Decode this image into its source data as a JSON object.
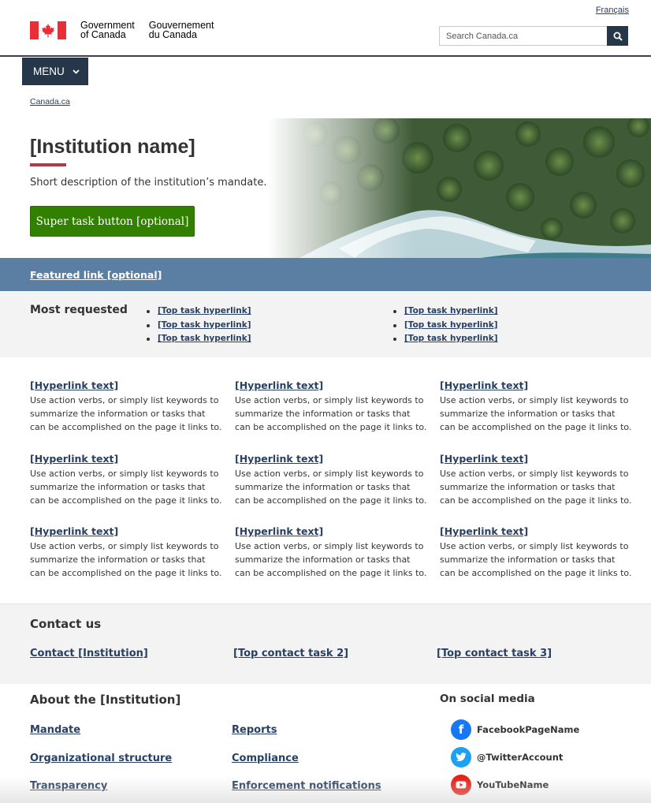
{
  "header": {
    "language_toggle": "Français",
    "signature": {
      "en_line1": "Government",
      "en_line2": "of Canada",
      "fr_line1": "Gouvernement",
      "fr_line2": "du Canada"
    },
    "search_placeholder": "Search Canada.ca",
    "search_icon": "search-icon",
    "accent_color": "#26374a",
    "flag_color": "#eb2d37"
  },
  "menu": {
    "label": "MENU"
  },
  "breadcrumb": {
    "items": [
      "Canada.ca"
    ]
  },
  "hero": {
    "title": "[Institution name]",
    "description": "Short description of the institution’s mandate.",
    "button_label": "Super task button [optional]",
    "button_color": "#318000"
  },
  "featured": {
    "label": "Featured link [optional]",
    "color": "#5a7fa3"
  },
  "most_requested": {
    "title": "Most requested",
    "col1": [
      "[Top task hyperlink]",
      "[Top task hyperlink]",
      "[Top task hyperlink]"
    ],
    "col2": [
      "[Top task hyperlink]",
      "[Top task hyperlink]",
      "[Top task hyperlink]"
    ]
  },
  "cards": [
    {
      "title": "[Hyperlink text]",
      "body": "Use action verbs, or simply list keywords to summarize the information or tasks that can be accomplished on the page it links to."
    },
    {
      "title": "[Hyperlink text]",
      "body": "Use action verbs, or simply list keywords to summarize the information or tasks that can be accomplished on the page it links to."
    },
    {
      "title": "[Hyperlink text]",
      "body": "Use action verbs, or simply list keywords to summarize the information or tasks that can be accomplished on the page it links to."
    },
    {
      "title": "[Hyperlink text]",
      "body": "Use action verbs, or simply list keywords to summarize the information or tasks that can be accomplished on the page it links to."
    },
    {
      "title": "[Hyperlink text]",
      "body": "Use action verbs, or simply list keywords to summarize the information or tasks that can be accomplished on the page it links to."
    },
    {
      "title": "[Hyperlink text]",
      "body": "Use action verbs, or simply list keywords to summarize the information or tasks that can be accomplished on the page it links to."
    },
    {
      "title": "[Hyperlink text]",
      "body": "Use action verbs, or simply list keywords to summarize the information or tasks that can be accomplished on the page it links to."
    },
    {
      "title": "[Hyperlink text]",
      "body": "Use action verbs, or simply list keywords to summarize the information or tasks that can be accomplished on the page it links to."
    },
    {
      "title": "[Hyperlink text]",
      "body": "Use action verbs, or simply list keywords to summarize the information or tasks that can be accomplished on the page it links to."
    }
  ],
  "contact": {
    "title": "Contact us",
    "links": [
      "Contact [Institution]",
      "[Top contact task 2]",
      "[Top contact task 3]"
    ]
  },
  "about": {
    "title": "About the [Institution]",
    "links": [
      "Mandate",
      "Reports",
      "Organizational structure",
      "Compliance",
      "Transparency",
      "Enforcement notifications"
    ]
  },
  "social": {
    "title": "On social media",
    "items": [
      {
        "name": "FacebookPageName",
        "icon": "facebook-icon",
        "color": "#1877f2"
      },
      {
        "name": "@TwitterAccount",
        "icon": "twitter-icon",
        "color": "#1da1f2"
      },
      {
        "name": "YouTubeName",
        "icon": "youtube-icon",
        "color": "#e62117"
      }
    ]
  }
}
